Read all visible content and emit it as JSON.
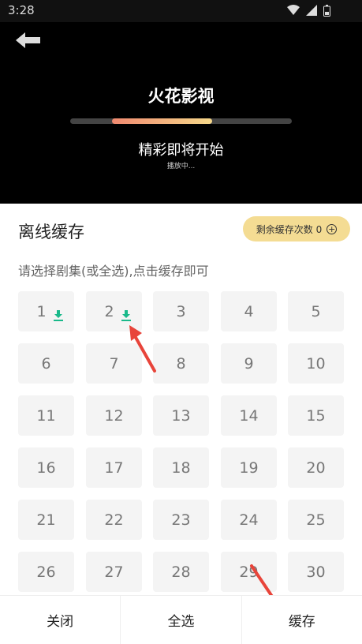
{
  "status": {
    "time": "3:28"
  },
  "player": {
    "title": "火花影视",
    "subtitle": "精彩即将开始",
    "small": "播放中...",
    "progress_start": 0.19,
    "progress_end": 0.64
  },
  "sheet": {
    "title": "离线缓存",
    "remain_label": "剩余缓存次数 0",
    "hint": "请选择剧集(或全选),点击缓存即可"
  },
  "episodes": [
    "1",
    "2",
    "3",
    "4",
    "5",
    "6",
    "7",
    "8",
    "9",
    "10",
    "11",
    "12",
    "13",
    "14",
    "15",
    "16",
    "17",
    "18",
    "19",
    "20",
    "21",
    "22",
    "23",
    "24",
    "25",
    "26",
    "27",
    "28",
    "29",
    "30"
  ],
  "downloaded": [
    0,
    1
  ],
  "bottom": {
    "close": "关闭",
    "select_all": "全选",
    "cache": "缓存"
  },
  "colors": {
    "accent": "#f4dc93",
    "download": "#19b98a",
    "arrow": "#e8443a"
  },
  "icons": {
    "back": "back-arrow-icon",
    "download": "download-icon",
    "plus": "plus-circle-icon"
  }
}
